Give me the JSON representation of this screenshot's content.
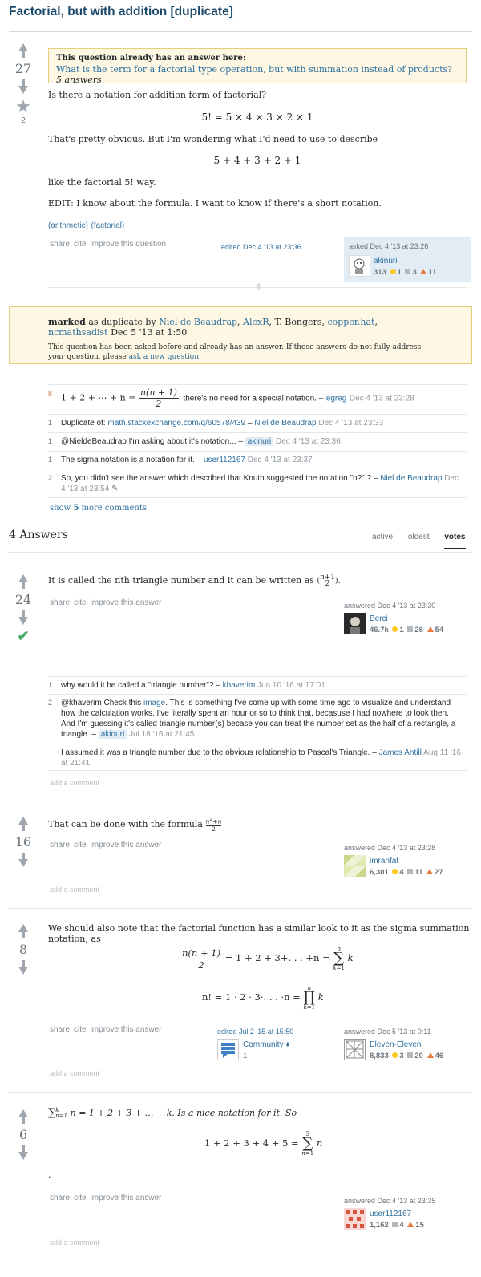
{
  "question": {
    "title": "Factorial, but with addition [duplicate]",
    "votes": "27",
    "favorites": "2",
    "notice_heading": "This question already has an answer here:",
    "notice_link": "What is the term for a factorial type operation, but with summation instead of products?",
    "notice_answers": "5 answers",
    "body_1": "Is there a notation for addition form of factorial?",
    "math_1": "5! = 5 × 4 × 3 × 2 × 1",
    "body_2": "That's pretty obvious. But I'm wondering what I'd need to use to describe",
    "math_2": "5 + 4 + 3 + 2 + 1",
    "body_3": "like the factorial 5! way.",
    "body_4": "EDIT: I know about the formula. I want to know if there's a short notation.",
    "tags": [
      "(arithmetic)",
      "(factorial)"
    ],
    "menu": [
      "share",
      "cite",
      "improve this question"
    ],
    "edited": "edited Dec 4 '13 at 23:36",
    "asked": "asked Dec 4 '13 at 23:26",
    "user": "akinuri",
    "rep": "313",
    "gold": "1",
    "silver": "3",
    "bronze": "11"
  },
  "duplicate": {
    "marked": "marked",
    "as_dup_by": "as duplicate by",
    "users": [
      "Niel de Beaudrap",
      "AlexR",
      "T. Bongers",
      "copper.hat",
      "ncmathsadist"
    ],
    "date": "Dec 5 '13 at 1:50",
    "text": "This question has been asked before and already has an answer. If those answers do not fully address your question, please",
    "link": "ask a new question."
  },
  "question_comments": [
    {
      "score": "8",
      "pre": "1 + 2 + ⋯ + n =",
      "num": "n(n + 1)",
      "den": "2",
      "text": "; there's no need for a special notation. –",
      "user": "egreg",
      "date": "Dec 4 '13 at 23:28"
    },
    {
      "score": "1",
      "text": "Duplicate of:",
      "link": "math.stackexchange.com/q/60578/439",
      "sep": " – ",
      "user": "Niel de Beaudrap",
      "date": "Dec 4 '13 at 23:33"
    },
    {
      "score": "1",
      "text": "@NieldeBeaudrap I'm asking about it's notation... –",
      "user": "akinuri",
      "date": "Dec 4 '13 at 23:36"
    },
    {
      "score": "1",
      "text": "The sigma notation is a notation for it. –",
      "user": "user112167",
      "date": "Dec 4 '13 at 23:37"
    },
    {
      "score": "2",
      "text": "So, you didn't see the answer which described that Knuth suggested the notation \"n?\" ? –",
      "user": "Niel de Beaudrap",
      "date": "Dec 4 '13 at 23:54"
    }
  ],
  "show_more": {
    "pre": "show",
    "count": "5",
    "post": "more comments"
  },
  "answers_header": "4 Answers",
  "tabs": [
    "active",
    "oldest",
    "votes"
  ],
  "answers": [
    {
      "votes": "24",
      "body": "It is called the nth triangle number and it can be written as",
      "menu": [
        "share",
        "cite",
        "improve this answer"
      ],
      "answered": "answered Dec 4 '13 at 23:30",
      "user": "Berci",
      "rep": "46.7k",
      "gold": "1",
      "silver": "26",
      "bronze": "54",
      "comments": [
        {
          "score": "1",
          "text": "why would it be called a \"triangle number\"? –",
          "user": "khaverim",
          "date": "Jun 10 '16 at 17:01"
        },
        {
          "score": "2",
          "pre": "@khaverim Check this",
          "link": "image",
          "text": ". This is something I've come up with some time ago to visualize and understand how the calculation works. I've literally spent an hour or so to think that, becasuse I had nowhere to look then. And I'm guessing it's called triangle number(s) becase you can treat the number set as the half of a rectangle, a triangle. –",
          "user": "akinuri",
          "date": "Jul 18 '16 at 21:45"
        },
        {
          "score": "",
          "text": "I assumed it was a triangle number due to the obvious relationship to Pascal's Triangle. –",
          "user": "James Antill",
          "date": "Aug 11 '16 at 21:41"
        }
      ],
      "add_comment": "add a comment"
    },
    {
      "votes": "16",
      "body": "That can be done with the formula",
      "menu": [
        "share",
        "cite",
        "improve this answer"
      ],
      "answered": "answered Dec 4 '13 at 23:28",
      "user": "imranfat",
      "rep": "6,301",
      "gold": "4",
      "silver": "11",
      "bronze": "27",
      "add_comment": "add a comment"
    },
    {
      "votes": "8",
      "body": "We should also note that the factorial function has a similar look to it as the sigma summation notation; as",
      "math_1": "= 1 + 2 + 3+. . . +n =",
      "math_2": "n! = 1 · 2 · 3·. . . ·n =",
      "menu": [
        "share",
        "cite",
        "improve this answer"
      ],
      "edited": "edited Jul 2 '15 at 15:50",
      "editor": "Community",
      "editor_rep": "1",
      "answered": "answered Dec 5 '13 at 0:11",
      "user": "Eleven-Eleven",
      "rep": "8,833",
      "gold": "3",
      "silver": "20",
      "bronze": "46",
      "add_comment": "add a comment"
    },
    {
      "votes": "6",
      "body": "n = 1 + 2 + 3 + … + k. Is a nice notation for it. So",
      "math_1": "1 + 2 + 3 + 4 + 5 =",
      "dot": ".",
      "menu": [
        "share",
        "cite",
        "improve this answer"
      ],
      "answered": "answered Dec 4 '13 at 23:35",
      "user": "user112167",
      "rep": "1,162",
      "silver": "4",
      "bronze": "15",
      "add_comment": "add a comment"
    }
  ],
  "colors": {
    "link": "#2e6f9e",
    "notice_bg": "#fdf7e3",
    "accept": "#48a868"
  }
}
